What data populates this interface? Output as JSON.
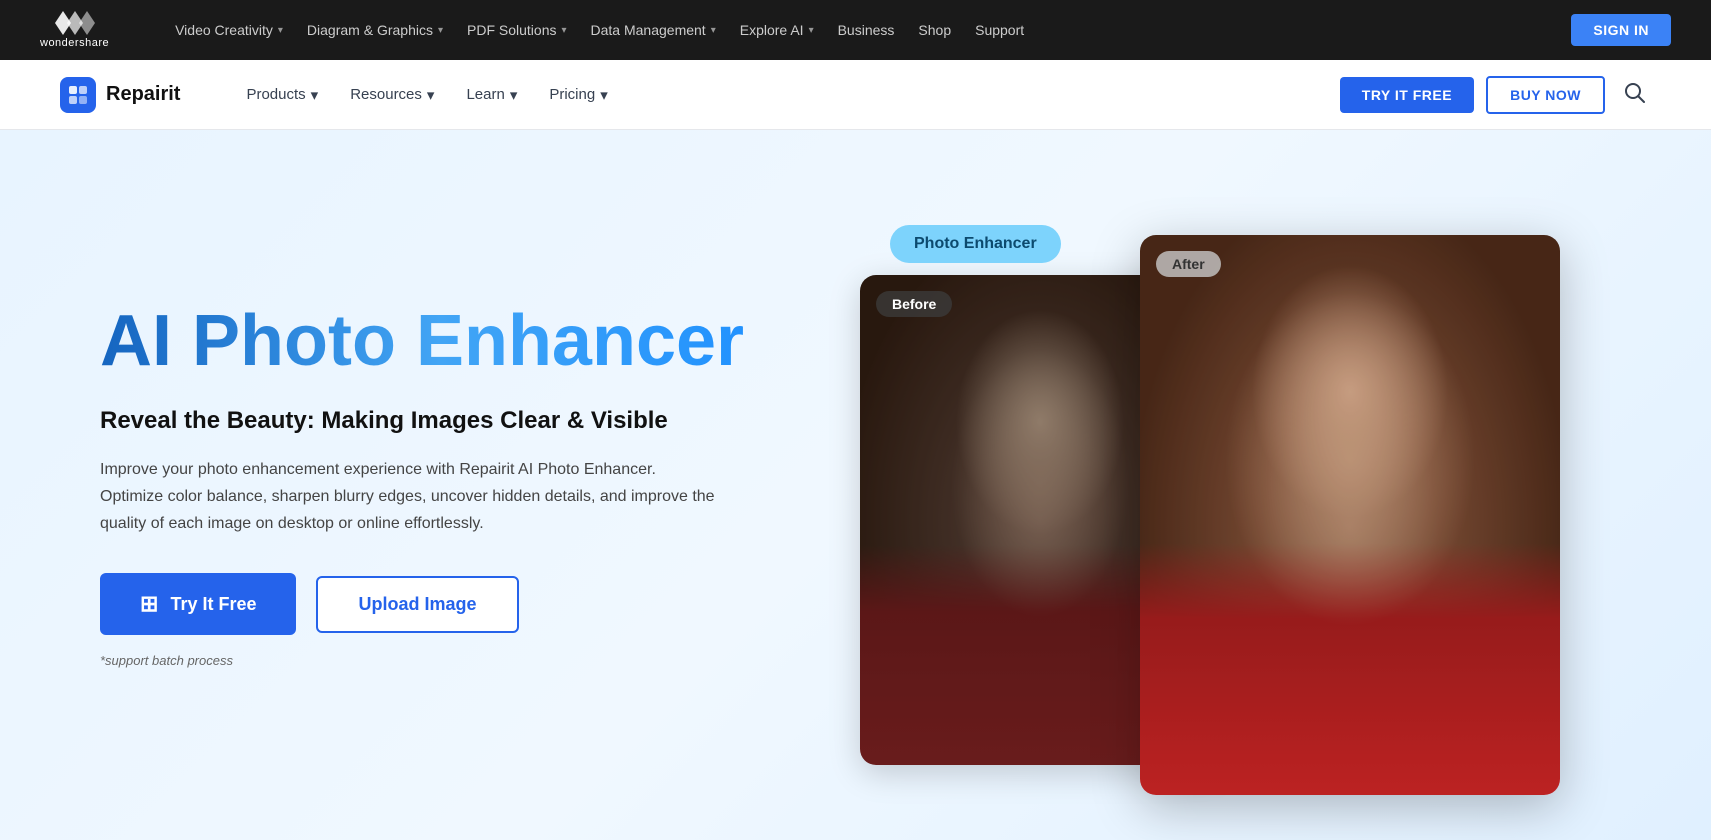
{
  "topNav": {
    "logo": {
      "icon": "♦♦",
      "name": "wondershare"
    },
    "items": [
      {
        "label": "Video Creativity",
        "hasDropdown": true
      },
      {
        "label": "Diagram & Graphics",
        "hasDropdown": true
      },
      {
        "label": "PDF Solutions",
        "hasDropdown": true
      },
      {
        "label": "Data Management",
        "hasDropdown": true
      },
      {
        "label": "Explore AI",
        "hasDropdown": true
      },
      {
        "label": "Business",
        "hasDropdown": false
      },
      {
        "label": "Shop",
        "hasDropdown": false
      },
      {
        "label": "Support",
        "hasDropdown": false
      }
    ],
    "signInLabel": "SIGN IN"
  },
  "secondNav": {
    "brandName": "Repairit",
    "items": [
      {
        "label": "Products",
        "hasDropdown": true
      },
      {
        "label": "Resources",
        "hasDropdown": true
      },
      {
        "label": "Learn",
        "hasDropdown": true
      },
      {
        "label": "Pricing",
        "hasDropdown": true
      }
    ],
    "tryItFreeLabel": "TRY IT FREE",
    "buyNowLabel": "BUY NOW"
  },
  "hero": {
    "title": "AI Photo Enhancer",
    "subtitle": "Reveal the Beauty: Making Images Clear & Visible",
    "description": "Improve your photo enhancement experience with Repairit AI Photo Enhancer. Optimize color balance, sharpen blurry edges, uncover hidden details, and improve the quality of each image on desktop or online effortlessly.",
    "tryItFreeLabel": "Try It Free",
    "uploadImageLabel": "Upload Image",
    "batchNote": "*support batch process",
    "photoBadge": "Photo Enhancer",
    "beforeLabel": "Before",
    "afterLabel": "After"
  }
}
